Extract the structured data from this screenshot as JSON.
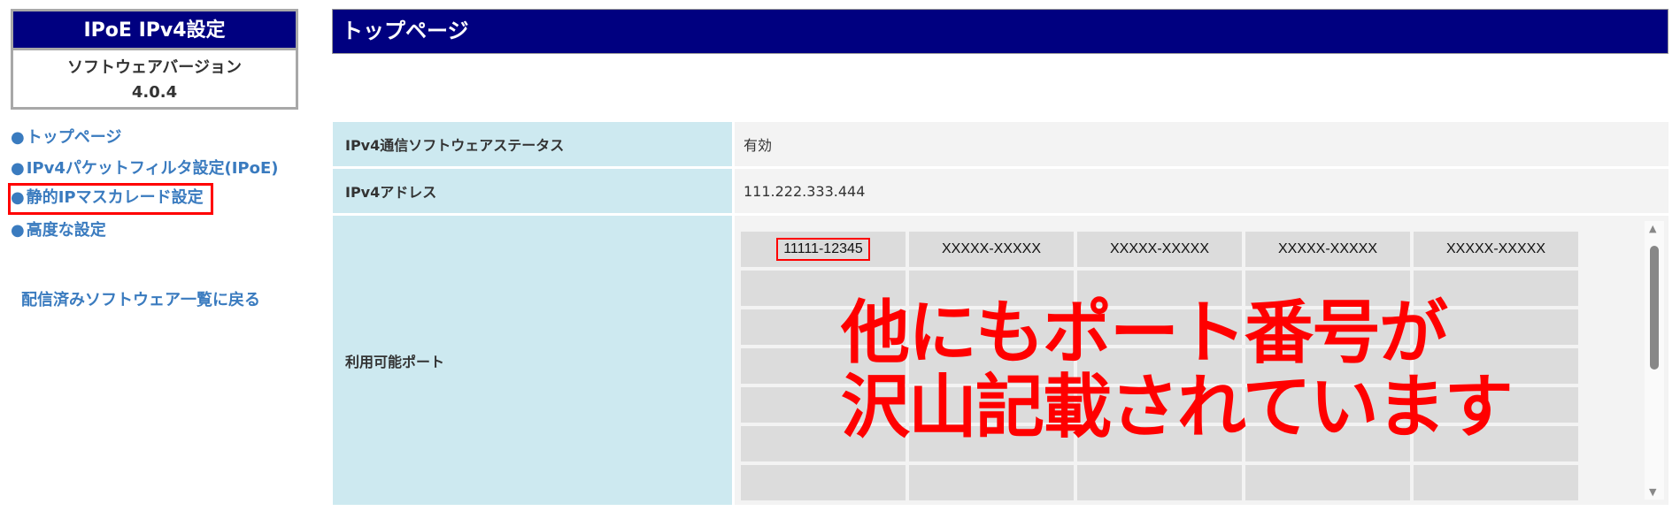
{
  "sidebar": {
    "title": "IPoE IPv4設定",
    "version_label": "ソフトウェアバージョン",
    "version": "4.0.4",
    "items": [
      {
        "label": "トップページ"
      },
      {
        "label": "IPv4パケットフィルタ設定(IPoE)"
      },
      {
        "label": "静的IPマスカレード設定"
      },
      {
        "label": "高度な設定"
      }
    ],
    "back_link": "配信済みソフトウェア一覧に戻る",
    "bullet": "●"
  },
  "header": {
    "title": "トップページ"
  },
  "table": {
    "rows": [
      {
        "label": "IPv4通信ソフトウェアステータス",
        "value": "有効"
      },
      {
        "label": "IPv4アドレス",
        "value": "111.222.333.444"
      },
      {
        "label": "利用可能ポート"
      }
    ]
  },
  "ports": [
    "11111-12345",
    "XXXXX-XXXXX",
    "XXXXX-XXXXX",
    "XXXXX-XXXXX",
    "XXXXX-XXXXX"
  ],
  "annotation": {
    "line1": "他にもポート番号が",
    "line2": "沢山記載されています"
  },
  "colors": {
    "header": "#000080",
    "link": "#3a7bbf",
    "label_bg": "#cde9f0",
    "highlight": "#ff0000"
  }
}
